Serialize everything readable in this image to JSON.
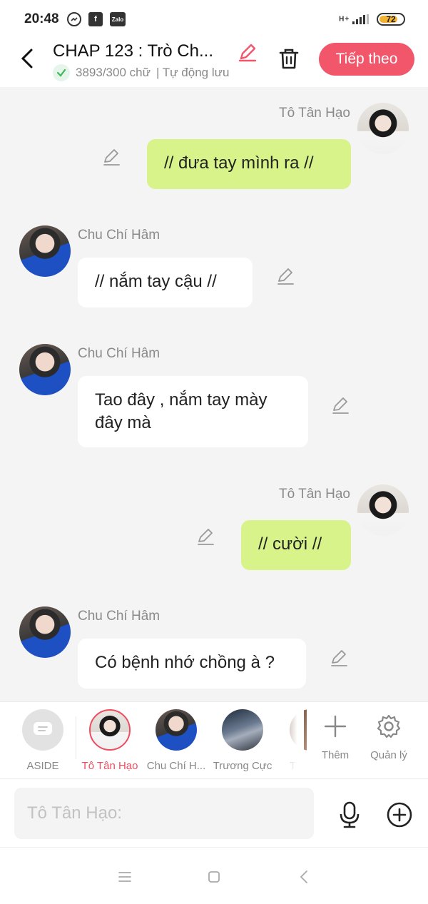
{
  "status_bar": {
    "time": "20:48",
    "battery_level": "72",
    "network": "H+",
    "icons": [
      "messenger-icon",
      "facebook-icon",
      "zalo-icon"
    ],
    "zalo_label": "Zalo"
  },
  "header": {
    "title": "CHAP 123 : Trò Ch...",
    "word_count": "3893/300 chữ",
    "autosave": "| Tự động lưu",
    "next_label": "Tiếp theo"
  },
  "colors": {
    "accent": "#f2566b",
    "my_bubble": "#d8f38a",
    "their_bubble": "#ffffff",
    "chat_background": "#f4f4f4"
  },
  "messages": [
    {
      "sender": "Tô Tân Hạo",
      "side": "right",
      "text": "// đưa tay mình ra //"
    },
    {
      "sender": "Chu Chí Hâm",
      "side": "left",
      "text": "// nắm tay cậu //"
    },
    {
      "sender": "Chu Chí Hâm",
      "side": "left",
      "text": "Tao đây , nắm tay mày đây mà"
    },
    {
      "sender": "Tô Tân Hạo",
      "side": "right",
      "text": "// cười //"
    },
    {
      "sender": "Chu Chí Hâm",
      "side": "left",
      "text": "Có bệnh nhớ chồng à ?"
    }
  ],
  "characters": [
    {
      "label": "ASIDE",
      "active": false
    },
    {
      "label": "Tô Tân Hạo",
      "active": true
    },
    {
      "label": "Chu Chí H...",
      "active": false
    },
    {
      "label": "Trương Cực",
      "active": false
    },
    {
      "label": "Tả",
      "active": false
    }
  ],
  "tools": {
    "add_label": "Thêm",
    "manage_label": "Quản lý"
  },
  "input": {
    "placeholder": "Tô Tân Hạo:"
  },
  "nav": {
    "icons": [
      "menu-icon",
      "home-icon",
      "back-nav-icon"
    ]
  }
}
